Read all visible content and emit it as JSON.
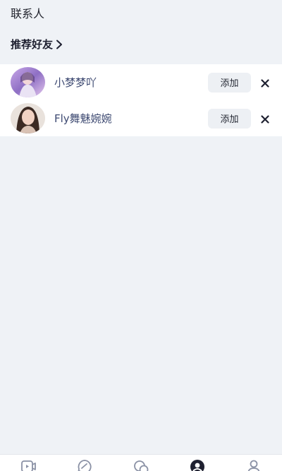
{
  "header": {
    "title": "联系人"
  },
  "recommended": {
    "label": "推荐好友",
    "arrow_icon": "chevron-right-icon",
    "friends": [
      {
        "name": "小梦梦吖",
        "add_label": "添加",
        "dismiss_icon": "close-icon"
      },
      {
        "name": "Fly舞魅婉婉",
        "add_label": "添加",
        "dismiss_icon": "close-icon"
      }
    ]
  },
  "tabbar": {
    "tabs": [
      {
        "icon": "video-icon",
        "active": false
      },
      {
        "icon": "chat-bubble-icon",
        "active": false
      },
      {
        "icon": "messages-icon",
        "active": false
      },
      {
        "icon": "contacts-icon",
        "active": true
      },
      {
        "icon": "profile-icon",
        "active": false
      }
    ]
  },
  "colors": {
    "background": "#eff2f6",
    "name_text": "#3e4a72",
    "button_bg": "#edf0f4",
    "tab_active": "#1e2030",
    "tab_inactive": "#8a91a5"
  }
}
